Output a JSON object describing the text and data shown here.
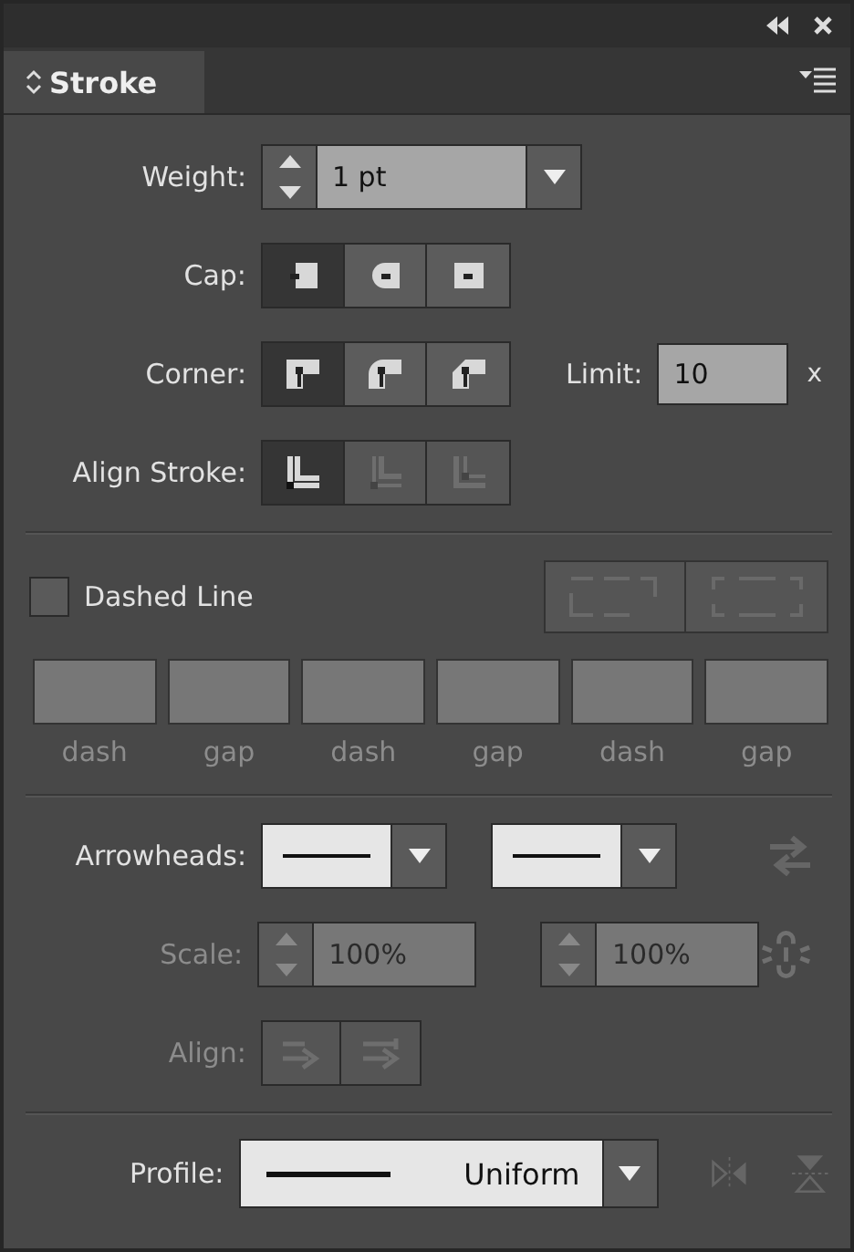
{
  "panel": {
    "tab": "Stroke"
  },
  "weight": {
    "label": "Weight:",
    "value": "1 pt"
  },
  "cap": {
    "label": "Cap:",
    "options": [
      {
        "kind": "butt",
        "selected": true
      },
      {
        "kind": "round",
        "selected": false
      },
      {
        "kind": "projecting",
        "selected": false
      }
    ]
  },
  "corner": {
    "label": "Corner:",
    "options": [
      {
        "kind": "miter",
        "selected": true
      },
      {
        "kind": "round",
        "selected": false
      },
      {
        "kind": "bevel",
        "selected": false
      }
    ],
    "limit": {
      "label": "Limit:",
      "value": "10",
      "unit": "x"
    }
  },
  "align_stroke": {
    "label": "Align Stroke:",
    "options": [
      {
        "kind": "center",
        "selected": true,
        "disabled": false
      },
      {
        "kind": "inside",
        "selected": false,
        "disabled": true
      },
      {
        "kind": "outside",
        "selected": false,
        "disabled": true
      }
    ]
  },
  "dashed_line": {
    "label": "Dashed Line",
    "checked": false,
    "buttons": [
      {
        "kind": "preserve",
        "disabled": true
      },
      {
        "kind": "align",
        "disabled": true
      }
    ],
    "fields": [
      {
        "label": "dash"
      },
      {
        "label": "gap"
      },
      {
        "label": "dash"
      },
      {
        "label": "gap"
      },
      {
        "label": "dash"
      },
      {
        "label": "gap"
      }
    ]
  },
  "arrowheads": {
    "label": "Arrowheads:",
    "menus": [
      {
        "kind": "none"
      },
      {
        "kind": "none"
      }
    ],
    "swap_disabled": true
  },
  "scale": {
    "label": "Scale:",
    "disabled": true,
    "values": [
      "100%",
      "100%"
    ]
  },
  "align": {
    "label": "Align:",
    "disabled": true
  },
  "profile": {
    "label": "Profile:",
    "value": "Uniform"
  }
}
